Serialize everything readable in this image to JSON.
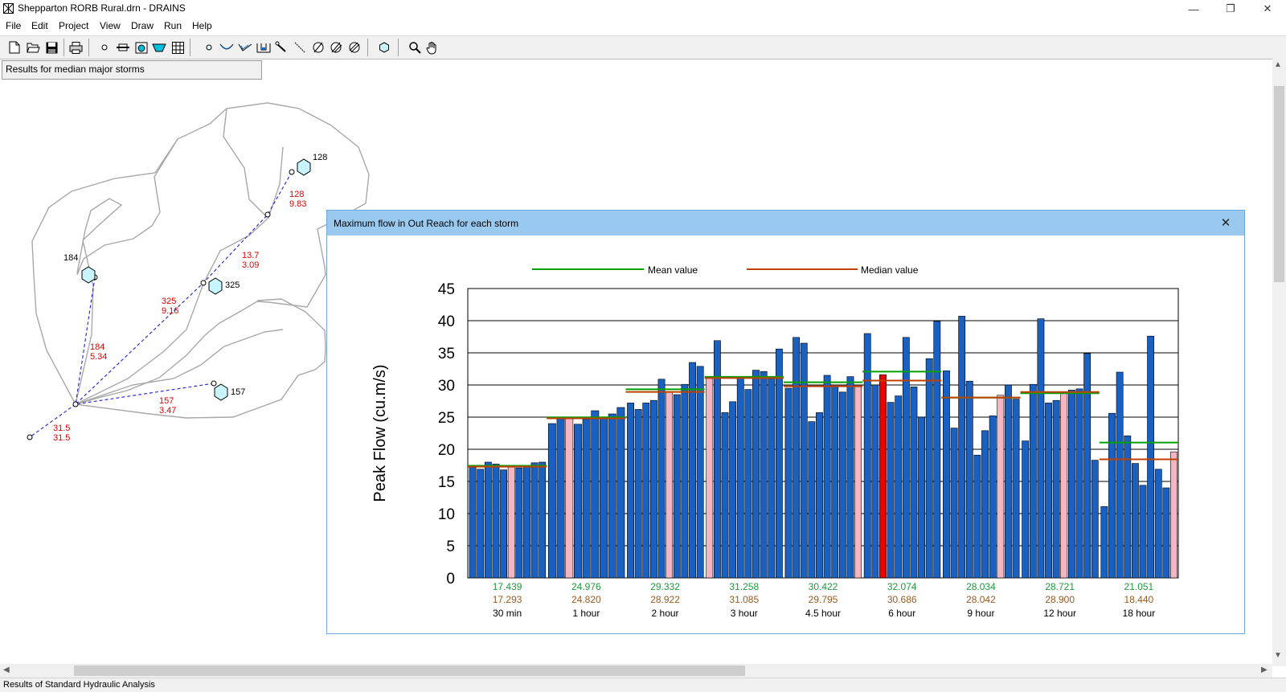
{
  "window": {
    "title": "Shepparton RORB Rural.drn - DRAINS",
    "controls": [
      "—",
      "❐",
      "✕"
    ]
  },
  "menu": [
    "File",
    "Edit",
    "Project",
    "View",
    "Draw",
    "Run",
    "Help"
  ],
  "results_label": "Results for median major storms",
  "status": "Results of Standard Hydraulic Analysis",
  "map": {
    "nodes": [
      {
        "name": "128",
        "label": "128",
        "flows": [
          "128",
          "9.83"
        ]
      },
      {
        "name": "184",
        "label": "184",
        "flows": [
          "184",
          "5.34"
        ]
      },
      {
        "name": "325",
        "label": "325",
        "flows": [
          "325",
          "9.16"
        ]
      },
      {
        "name": "157",
        "label": "157",
        "flows": [
          "157",
          "3.47"
        ]
      }
    ],
    "reach_flows": [
      "13.7",
      "3.09"
    ],
    "outlet_flows": [
      "31.5",
      "31.5"
    ]
  },
  "dialog": {
    "title": "Maximum flow in Out Reach for each storm",
    "close": "✕"
  },
  "colors": {
    "mean": "#00a000",
    "median": "#c04000",
    "bar": "#1a60c0",
    "median_bar": "#f4b6c2",
    "critical_bar": "#ee0000",
    "mean_text": "#1e9a3c",
    "median_text": "#9a5a20"
  },
  "chart_data": {
    "type": "bar",
    "ylabel": "Peak Flow (cu.m/s)",
    "ylim": [
      0,
      45
    ],
    "yticks": [
      "0",
      "5",
      "10",
      "15",
      "20",
      "25",
      "30",
      "35",
      "40",
      "45"
    ],
    "legend": [
      "Mean value",
      "Median value"
    ],
    "groups": [
      {
        "label": "30 min",
        "mean": "17.439",
        "median": "17.293",
        "bars": [
          17.2,
          16.9,
          18.0,
          17.7,
          16.8,
          17.3,
          17.1,
          17.3,
          17.9,
          18.0
        ],
        "highlight": 5
      },
      {
        "label": "1 hour",
        "mean": "24.976",
        "median": "24.820",
        "bars": [
          24.0,
          25.0,
          24.8,
          23.9,
          24.7,
          26.0,
          24.8,
          25.5,
          26.5
        ],
        "highlight": 2
      },
      {
        "label": "2 hour",
        "mean": "29.332",
        "median": "28.922",
        "bars": [
          27.2,
          26.2,
          27.2,
          27.6,
          30.9,
          28.9,
          28.5,
          30.1,
          33.5,
          32.9
        ],
        "highlight": 5
      },
      {
        "label": "3 hour",
        "mean": "31.258",
        "median": "31.085",
        "bars": [
          31.1,
          36.9,
          25.7,
          27.4,
          31.1,
          29.3,
          32.3,
          32.1,
          31.0,
          35.6
        ],
        "highlight": 0
      },
      {
        "label": "4.5 hour",
        "mean": "30.422",
        "median": "29.795",
        "bars": [
          29.5,
          37.4,
          36.5,
          24.3,
          25.7,
          31.5,
          29.8,
          28.9,
          31.3,
          29.8
        ],
        "highlight": 9
      },
      {
        "label": "6 hour",
        "mean": "32.074",
        "median": "30.686",
        "bars": [
          38.0,
          30.0,
          31.6,
          27.3,
          28.3,
          37.4,
          29.7,
          25.0,
          34.1,
          39.9
        ],
        "highlight": 2,
        "critical": true
      },
      {
        "label": "9 hour",
        "mean": "28.034",
        "median": "28.042",
        "bars": [
          32.2,
          23.3,
          40.7,
          30.6,
          19.1,
          22.9,
          25.2,
          28.4,
          30.0,
          27.8
        ],
        "highlight": 7
      },
      {
        "label": "12 hour",
        "mean": "28.721",
        "median": "28.900",
        "bars": [
          21.3,
          30.1,
          40.3,
          27.2,
          27.6,
          28.9,
          29.2,
          29.4,
          34.9,
          18.3
        ],
        "highlight": 5
      },
      {
        "label": "18 hour",
        "mean": "21.051",
        "median": "18.440",
        "bars": [
          11.1,
          25.6,
          32.0,
          22.1,
          17.8,
          14.4,
          37.6,
          16.9,
          14.0,
          19.6
        ],
        "highlight": 9
      }
    ]
  }
}
